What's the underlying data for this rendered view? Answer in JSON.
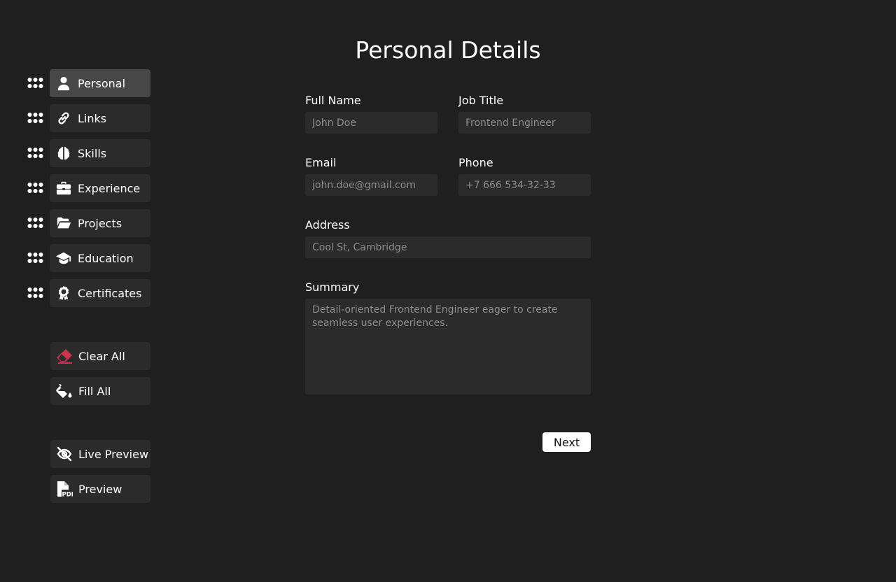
{
  "page": {
    "title": "Personal Details"
  },
  "sections": [
    {
      "label": "Personal",
      "icon": "user-icon",
      "active": true
    },
    {
      "label": "Links",
      "icon": "link-icon",
      "active": false
    },
    {
      "label": "Skills",
      "icon": "brain-icon",
      "active": false
    },
    {
      "label": "Experience",
      "icon": "briefcase-icon",
      "active": false
    },
    {
      "label": "Projects",
      "icon": "folder-open-icon",
      "active": false
    },
    {
      "label": "Education",
      "icon": "graduation-cap-icon",
      "active": false
    },
    {
      "label": "Certificates",
      "icon": "award-icon",
      "active": false
    }
  ],
  "actions": {
    "clear_all": {
      "label": "Clear All",
      "icon": "eraser-icon",
      "color": "#c9354d"
    },
    "fill_all": {
      "label": "Fill All",
      "icon": "fill-bucket-icon"
    },
    "live_preview": {
      "label": "Live Preview",
      "icon": "eye-slash-icon"
    },
    "preview": {
      "label": "Preview",
      "icon": "pdf-file-icon"
    }
  },
  "form": {
    "full_name": {
      "label": "Full Name",
      "placeholder": "John Doe"
    },
    "job_title": {
      "label": "Job Title",
      "placeholder": "Frontend Engineer"
    },
    "email": {
      "label": "Email",
      "placeholder": "john.doe@gmail.com"
    },
    "phone": {
      "label": "Phone",
      "placeholder": "+7 666 534-32-33"
    },
    "address": {
      "label": "Address",
      "placeholder": "Cool St, Cambridge"
    },
    "summary": {
      "label": "Summary",
      "placeholder": "Detail-oriented Frontend Engineer eager to create seamless user experiences."
    },
    "next_label": "Next"
  },
  "colors": {
    "background": "#1f1f1f",
    "button": "#2b2b2b",
    "active_button": "#474747",
    "accent_danger": "#c9354d"
  }
}
